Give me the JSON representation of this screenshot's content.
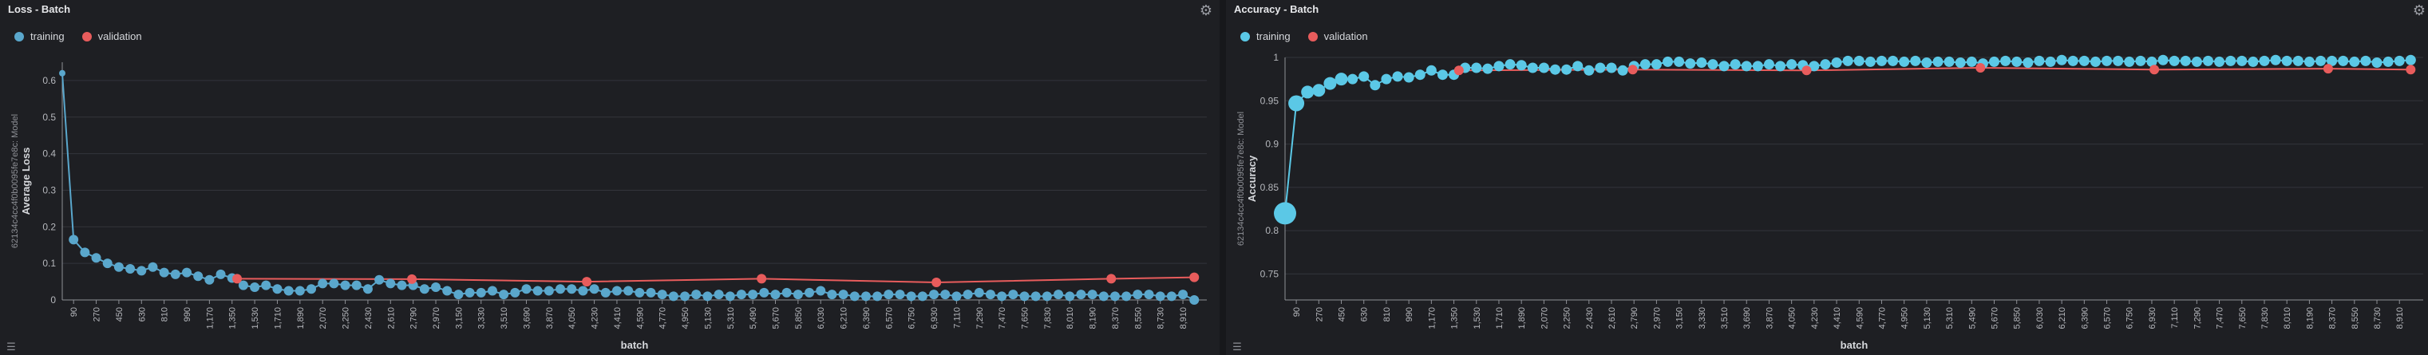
{
  "colors": {
    "training": "#5bc8e6",
    "training_left": "#5aa7cc",
    "validation": "#e85c5c",
    "grid": "#33353b",
    "axis": "#8e9096"
  },
  "icons": {
    "settings": "gear-icon",
    "menu": "menu-icon"
  },
  "panels": [
    {
      "title": "Loss - Batch",
      "legend": [
        {
          "label": "training"
        },
        {
          "label": "validation"
        }
      ],
      "ylabel": "Average Loss",
      "run_label": "62134c4cc4f0b0095fe7e8c: Model",
      "xlabel": "batch"
    },
    {
      "title": "Accuracy - Batch",
      "legend": [
        {
          "label": "training"
        },
        {
          "label": "validation"
        }
      ],
      "ylabel": "Accuracy",
      "run_label": "62134c4cc4f0b0095fe7e8c: Model",
      "xlabel": "batch"
    }
  ],
  "x_tick_labels": [
    "90",
    "270",
    "450",
    "630",
    "810",
    "990",
    "1,170",
    "1,350",
    "1,530",
    "1,710",
    "1,890",
    "2,070",
    "2,250",
    "2,430",
    "2,610",
    "2,790",
    "2,970",
    "3,150",
    "3,330",
    "3,510",
    "3,690",
    "3,870",
    "4,050",
    "4,230",
    "4,410",
    "4,590",
    "4,770",
    "4,950",
    "5,130",
    "5,310",
    "5,490",
    "5,670",
    "5,850",
    "6,030",
    "6,210",
    "6,390",
    "6,570",
    "6,750",
    "6,930",
    "7,110",
    "7,290",
    "7,470",
    "7,650",
    "7,830",
    "8,010",
    "8,190",
    "8,370",
    "8,550",
    "8,730",
    "8,910"
  ],
  "chart_data": [
    {
      "type": "scatter",
      "title": "Loss - Batch",
      "xlabel": "batch",
      "ylabel": "Average Loss",
      "xlim": [
        0,
        9100
      ],
      "ylim": [
        0,
        0.65
      ],
      "yticks": [
        0,
        0.1,
        0.2,
        0.3,
        0.4,
        0.5,
        0.6
      ],
      "legend": "top-left",
      "grid": true,
      "series": [
        {
          "name": "training",
          "x": [
            0,
            90,
            180,
            270,
            360,
            450,
            540,
            630,
            720,
            810,
            900,
            990,
            1080,
            1170,
            1260,
            1350,
            1440,
            1530,
            1620,
            1710,
            1800,
            1890,
            1980,
            2070,
            2160,
            2250,
            2340,
            2430,
            2520,
            2610,
            2700,
            2790,
            2880,
            2970,
            3060,
            3150,
            3240,
            3330,
            3420,
            3510,
            3600,
            3690,
            3780,
            3870,
            3960,
            4050,
            4140,
            4230,
            4320,
            4410,
            4500,
            4590,
            4680,
            4770,
            4860,
            4950,
            5040,
            5130,
            5220,
            5310,
            5400,
            5490,
            5580,
            5670,
            5760,
            5850,
            5940,
            6030,
            6120,
            6210,
            6300,
            6390,
            6480,
            6570,
            6660,
            6750,
            6840,
            6930,
            7020,
            7110,
            7200,
            7290,
            7380,
            7470,
            7560,
            7650,
            7740,
            7830,
            7920,
            8010,
            8100,
            8190,
            8280,
            8370,
            8460,
            8550,
            8640,
            8730,
            8820,
            8910,
            9000
          ],
          "values": [
            0.62,
            0.165,
            0.13,
            0.115,
            0.1,
            0.09,
            0.085,
            0.08,
            0.09,
            0.075,
            0.07,
            0.075,
            0.065,
            0.055,
            0.07,
            0.06,
            0.04,
            0.035,
            0.04,
            0.03,
            0.025,
            0.025,
            0.03,
            0.045,
            0.045,
            0.04,
            0.04,
            0.03,
            0.055,
            0.045,
            0.04,
            0.04,
            0.03,
            0.035,
            0.025,
            0.015,
            0.02,
            0.02,
            0.025,
            0.015,
            0.02,
            0.03,
            0.025,
            0.025,
            0.03,
            0.03,
            0.025,
            0.03,
            0.02,
            0.025,
            0.025,
            0.02,
            0.02,
            0.015,
            0.01,
            0.01,
            0.015,
            0.01,
            0.015,
            0.01,
            0.015,
            0.015,
            0.02,
            0.015,
            0.02,
            0.015,
            0.02,
            0.025,
            0.015,
            0.015,
            0.01,
            0.01,
            0.01,
            0.015,
            0.015,
            0.01,
            0.01,
            0.015,
            0.015,
            0.01,
            0.015,
            0.02,
            0.015,
            0.01,
            0.015,
            0.01,
            0.01,
            0.01,
            0.015,
            0.01,
            0.015,
            0.015,
            0.01,
            0.01,
            0.01,
            0.015,
            0.015,
            0.01,
            0.01,
            0.015,
            0.0
          ]
        },
        {
          "name": "validation",
          "x": [
            1390,
            2780,
            4170,
            5560,
            6950,
            8340,
            9000
          ],
          "values": [
            0.058,
            0.057,
            0.05,
            0.058,
            0.048,
            0.058,
            0.062
          ]
        }
      ]
    },
    {
      "type": "scatter",
      "title": "Accuracy - Batch",
      "xlabel": "batch",
      "ylabel": "Accuracy",
      "xlim": [
        0,
        9100
      ],
      "ylim": [
        0.72,
        1.0
      ],
      "yticks": [
        0.75,
        0.8,
        0.85,
        0.9,
        0.95,
        1
      ],
      "legend": "top-left",
      "grid": true,
      "series": [
        {
          "name": "training",
          "x": [
            0,
            90,
            180,
            270,
            360,
            450,
            540,
            630,
            720,
            810,
            900,
            990,
            1080,
            1170,
            1260,
            1350,
            1440,
            1530,
            1620,
            1710,
            1800,
            1890,
            1980,
            2070,
            2160,
            2250,
            2340,
            2430,
            2520,
            2610,
            2700,
            2790,
            2880,
            2970,
            3060,
            3150,
            3240,
            3330,
            3420,
            3510,
            3600,
            3690,
            3780,
            3870,
            3960,
            4050,
            4140,
            4230,
            4320,
            4410,
            4500,
            4590,
            4680,
            4770,
            4860,
            4950,
            5040,
            5130,
            5220,
            5310,
            5400,
            5490,
            5580,
            5670,
            5760,
            5850,
            5940,
            6030,
            6120,
            6210,
            6300,
            6390,
            6480,
            6570,
            6660,
            6750,
            6840,
            6930,
            7020,
            7110,
            7200,
            7290,
            7380,
            7470,
            7560,
            7650,
            7740,
            7830,
            7920,
            8010,
            8100,
            8190,
            8280,
            8370,
            8460,
            8550,
            8640,
            8730,
            8820,
            8910,
            9000
          ],
          "values": [
            0.82,
            0.947,
            0.96,
            0.962,
            0.97,
            0.975,
            0.975,
            0.978,
            0.968,
            0.975,
            0.978,
            0.977,
            0.98,
            0.985,
            0.98,
            0.98,
            0.988,
            0.988,
            0.987,
            0.99,
            0.992,
            0.991,
            0.988,
            0.988,
            0.986,
            0.986,
            0.99,
            0.985,
            0.988,
            0.988,
            0.985,
            0.99,
            0.992,
            0.992,
            0.995,
            0.995,
            0.993,
            0.994,
            0.992,
            0.99,
            0.992,
            0.99,
            0.99,
            0.992,
            0.99,
            0.992,
            0.991,
            0.99,
            0.992,
            0.994,
            0.996,
            0.996,
            0.995,
            0.996,
            0.996,
            0.995,
            0.996,
            0.994,
            0.995,
            0.995,
            0.994,
            0.995,
            0.993,
            0.995,
            0.996,
            0.995,
            0.994,
            0.996,
            0.995,
            0.997,
            0.996,
            0.996,
            0.995,
            0.996,
            0.996,
            0.995,
            0.996,
            0.995,
            0.997,
            0.996,
            0.996,
            0.995,
            0.996,
            0.995,
            0.996,
            0.996,
            0.995,
            0.996,
            0.997,
            0.996,
            0.996,
            0.995,
            0.996,
            0.996,
            0.996,
            0.995,
            0.996,
            0.994,
            0.995,
            0.996,
            0.997
          ]
        },
        {
          "name": "validation",
          "x": [
            1390,
            2780,
            4170,
            5560,
            6950,
            8340,
            9000
          ],
          "values": [
            0.985,
            0.986,
            0.985,
            0.988,
            0.986,
            0.987,
            0.986
          ]
        }
      ]
    }
  ]
}
